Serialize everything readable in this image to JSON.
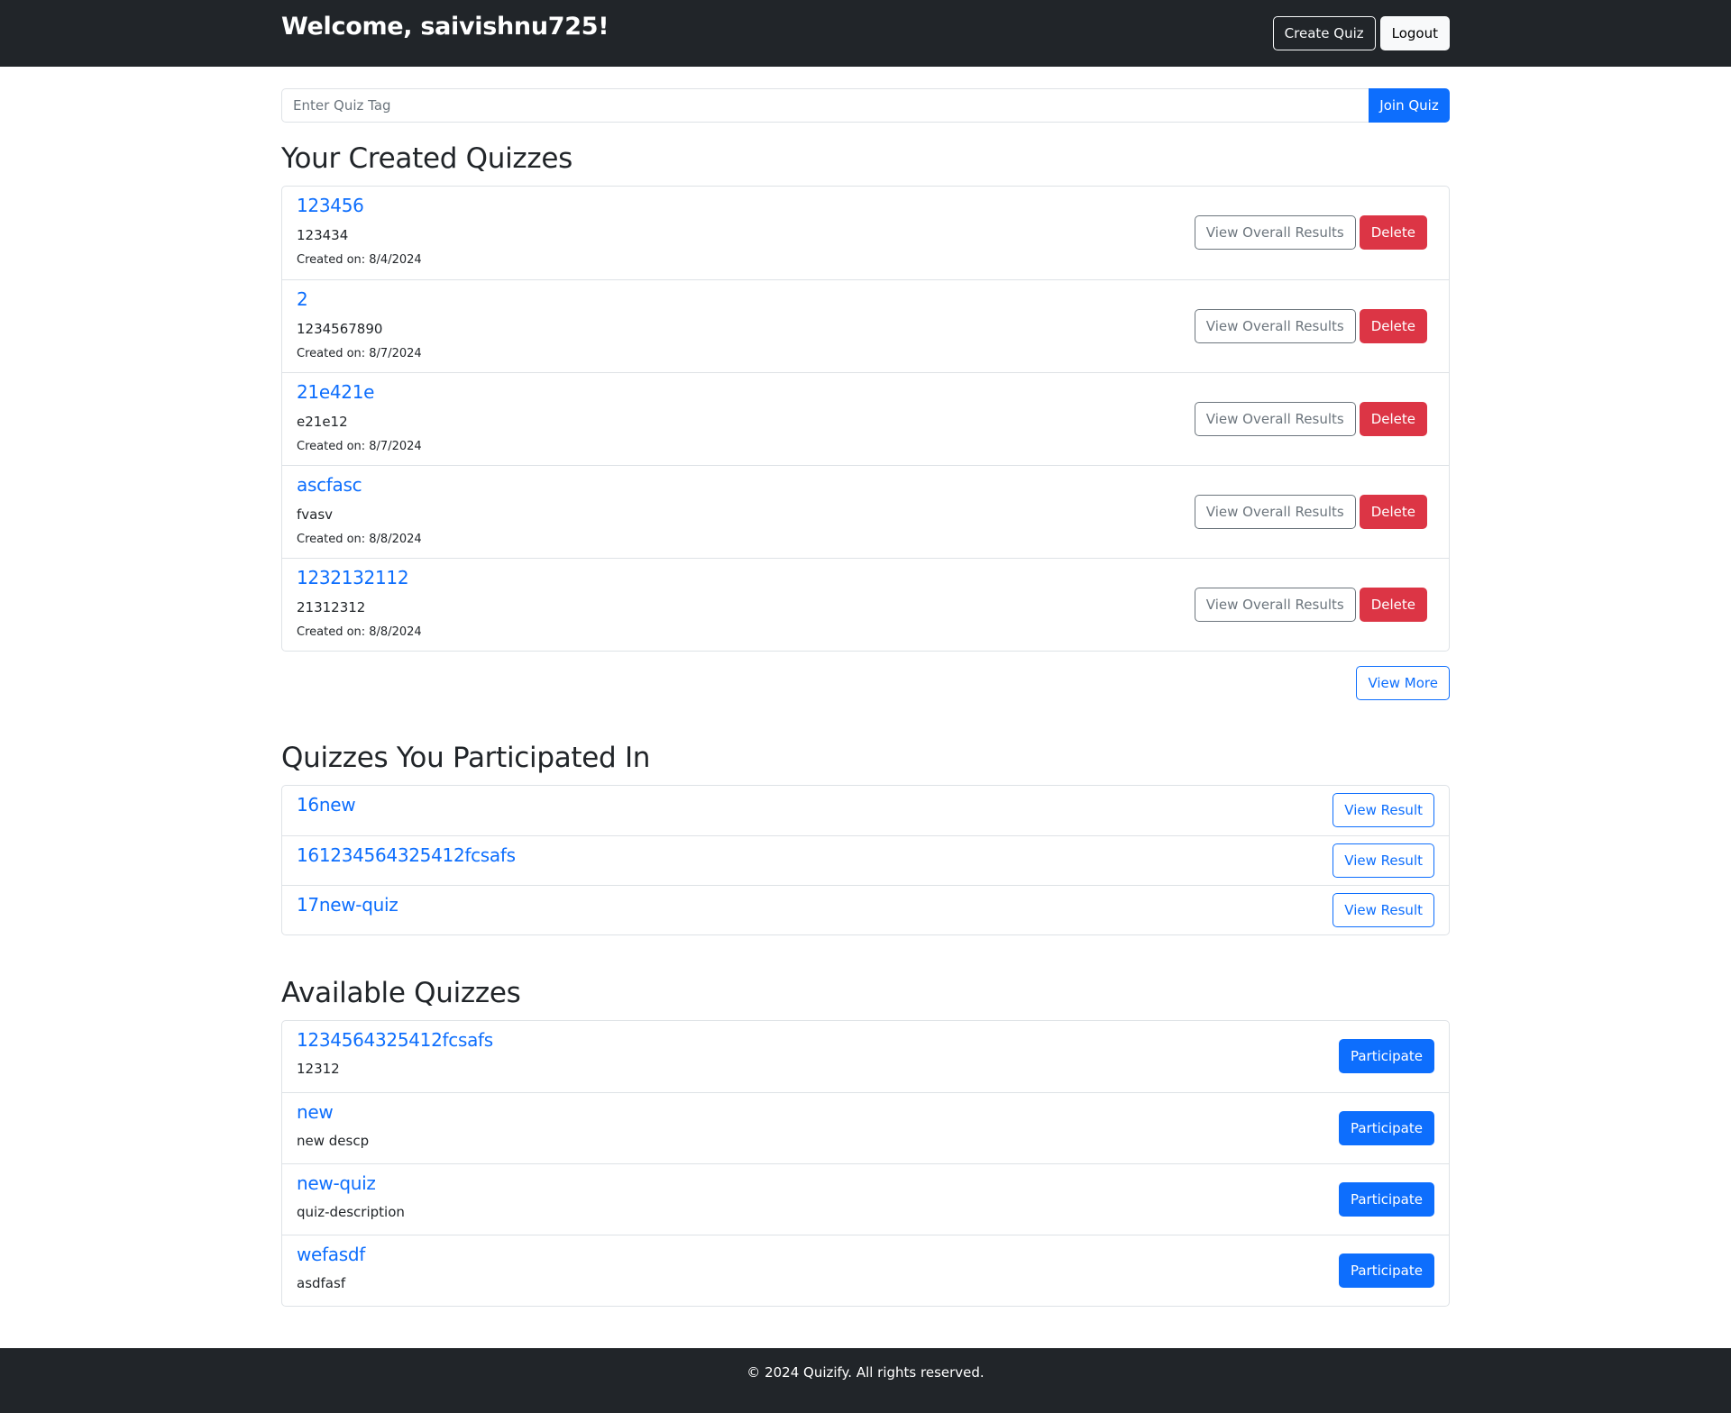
{
  "header": {
    "welcome": "Welcome, saivishnu725!",
    "create_quiz_label": "Create Quiz",
    "logout_label": "Logout"
  },
  "join": {
    "placeholder": "Enter Quiz Tag",
    "button_label": "Join Quiz"
  },
  "created": {
    "heading": "Your Created Quizzes",
    "view_results_label": "View Overall Results",
    "delete_label": "Delete",
    "view_more_label": "View More",
    "items": [
      {
        "title": "123456",
        "description": "123434",
        "created": "Created on: 8/4/2024"
      },
      {
        "title": "2",
        "description": "1234567890",
        "created": "Created on: 8/7/2024"
      },
      {
        "title": "21e421e",
        "description": "e21e12",
        "created": "Created on: 8/7/2024"
      },
      {
        "title": "ascfasc",
        "description": "fvasv",
        "created": "Created on: 8/8/2024"
      },
      {
        "title": "1232132112",
        "description": "21312312",
        "created": "Created on: 8/8/2024"
      }
    ]
  },
  "participated": {
    "heading": "Quizzes You Participated In",
    "view_result_label": "View Result",
    "items": [
      {
        "title": "16new"
      },
      {
        "title": "161234564325412fcsafs"
      },
      {
        "title": "17new-quiz"
      }
    ]
  },
  "available": {
    "heading": "Available Quizzes",
    "participate_label": "Participate",
    "items": [
      {
        "title": "1234564325412fcsafs",
        "description": "12312"
      },
      {
        "title": "new",
        "description": "new descp"
      },
      {
        "title": "new-quiz",
        "description": "quiz-description"
      },
      {
        "title": "wefasdf",
        "description": "asdfasf"
      }
    ]
  },
  "footer": {
    "text": "© 2024 Quizify. All rights reserved."
  },
  "colors": {
    "navbar": "#212529",
    "primary": "#0d6efd",
    "danger": "#dc3545",
    "secondary": "#6c757d"
  }
}
